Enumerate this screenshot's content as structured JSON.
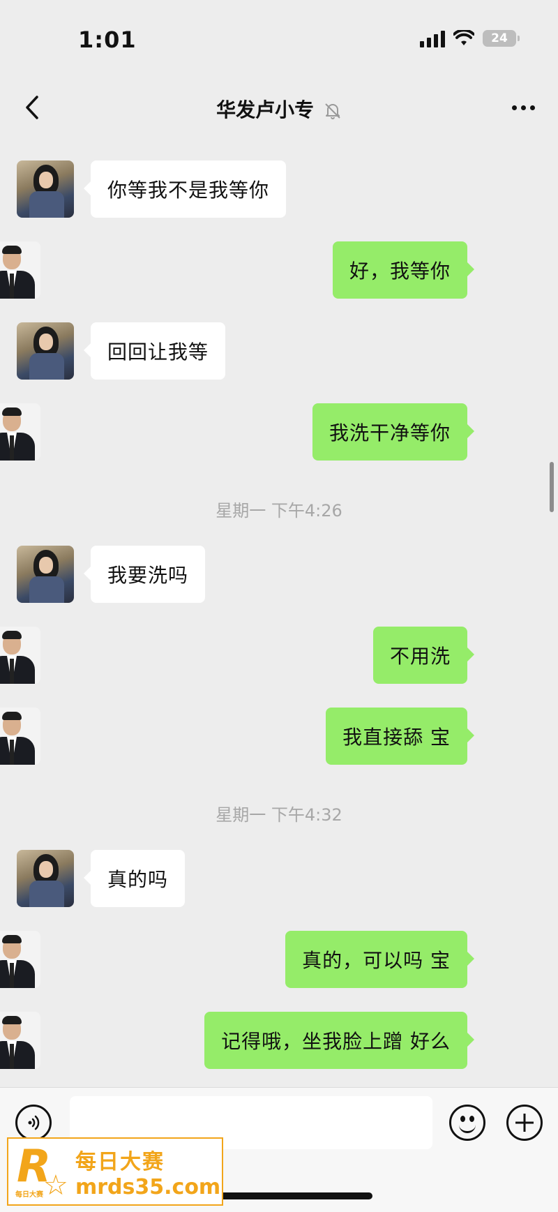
{
  "status_bar": {
    "time": "1:01",
    "battery": "24"
  },
  "header": {
    "title": "华发卢小专",
    "icons": [
      "back-icon",
      "mute-bell-icon",
      "more-icon"
    ]
  },
  "timestamps": [
    "星期一 下午4:26",
    "星期一 下午4:32"
  ],
  "messages": [
    {
      "side": "left",
      "text": "你等我不是我等你"
    },
    {
      "side": "right",
      "text": "好，我等你"
    },
    {
      "side": "left",
      "text": "回回让我等"
    },
    {
      "side": "right",
      "text": "我洗干净等你"
    },
    {
      "side": "left",
      "text": "我要洗吗"
    },
    {
      "side": "right",
      "text": "不用洗"
    },
    {
      "side": "right",
      "text": "我直接舔 宝"
    },
    {
      "side": "left",
      "text": "真的吗"
    },
    {
      "side": "right",
      "text": "真的，可以吗 宝"
    },
    {
      "side": "right",
      "text": "记得哦，坐我脸上蹭 好么"
    }
  ],
  "input_bar": {
    "input_value": "",
    "icons": [
      "voice-icon",
      "emoji-icon",
      "plus-icon"
    ]
  },
  "watermark": {
    "line1": "每日大赛",
    "line2": "mrds35.com",
    "logo_letter": "R",
    "logo_small": "每日大赛"
  },
  "colors": {
    "background": "#ededed",
    "sent_bubble": "#95ec69",
    "received_bubble": "#ffffff",
    "watermark": "#f2a51a"
  }
}
